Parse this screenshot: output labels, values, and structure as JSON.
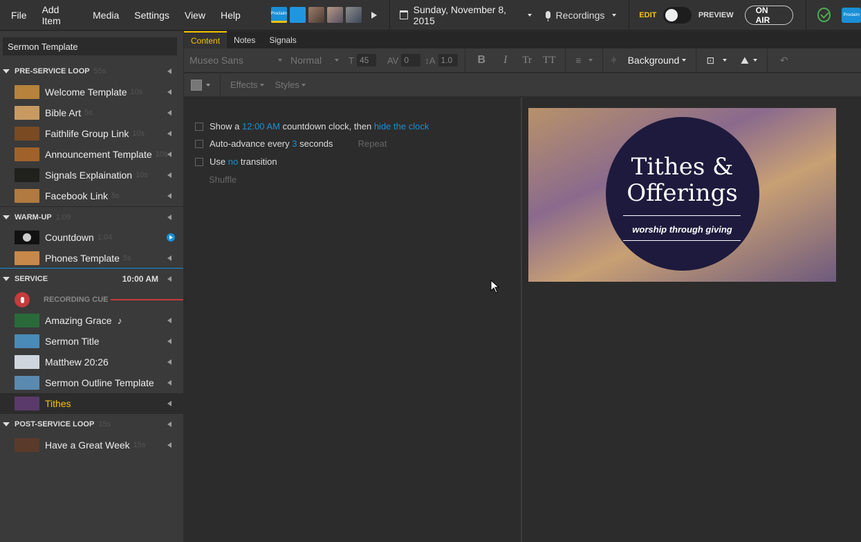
{
  "menu": [
    "File",
    "Add Item",
    "Media",
    "Settings",
    "View",
    "Help"
  ],
  "proclaim_logo_text": "Proclaim",
  "date": "Sunday, November 8, 2015",
  "recordings": "Recordings",
  "mode": {
    "edit": "EDIT",
    "preview": "PREVIEW"
  },
  "on_air": "ON AIR",
  "search": {
    "value": "Sermon Template"
  },
  "sections": [
    {
      "title": "PRE-SERVICE LOOP",
      "duration": "55s",
      "items": [
        {
          "label": "Welcome Template",
          "duration": "10s",
          "color": "#b7823c"
        },
        {
          "label": "Bible Art",
          "duration": "5s",
          "color": "#c89a62"
        },
        {
          "label": "Faithlife Group Link",
          "duration": "10s",
          "color": "#7a4a22"
        },
        {
          "label": "Announcement Template",
          "duration": "10s",
          "color": "#a0622a"
        },
        {
          "label": "Signals Explaination",
          "duration": "10s",
          "color": "#20201c"
        },
        {
          "label": "Facebook Link",
          "duration": "5s",
          "color": "#b07a40"
        }
      ]
    },
    {
      "title": "WARM-UP",
      "duration": "1:09",
      "items": [
        {
          "label": "Countdown",
          "duration": "1:04",
          "color": "#111111"
        },
        {
          "label": "Phones Template",
          "duration": "5s",
          "color": "#c8884a"
        }
      ]
    },
    {
      "title": "SERVICE",
      "time": "10:00 AM",
      "recording_cue": "RECORDING CUE",
      "items": [
        {
          "label": "Amazing Grace",
          "duration": "",
          "color": "#2a6a3a"
        },
        {
          "label": "Sermon Title",
          "duration": "",
          "color": "#4a8ab8"
        },
        {
          "label": "Matthew 20:26",
          "duration": "",
          "color": "#cfd6de"
        },
        {
          "label": "Sermon Outline Template",
          "duration": "",
          "color": "#5a8ab0"
        },
        {
          "label": "Tithes",
          "duration": "",
          "color": "#5a3a6a"
        }
      ]
    },
    {
      "title": "POST-SERVICE LOOP",
      "duration": "15s",
      "items": [
        {
          "label": "Have a Great Week",
          "duration": "15s",
          "color": "#5a3a2a"
        }
      ]
    }
  ],
  "tabs": [
    "Content",
    "Notes",
    "Signals"
  ],
  "toolbar": {
    "font": "Museo Sans",
    "weight": "Normal",
    "size": "45",
    "spacing": "0",
    "line_height": "1.0",
    "bold": "B",
    "italic": "I",
    "case1": "Tr",
    "case2": "TT",
    "background": "Background",
    "effects": "Effects",
    "styles": "Styles"
  },
  "options": {
    "opt1": {
      "pre": "Show a",
      "time": "12:00 AM",
      "mid": "countdown clock, then",
      "link": "hide the clock"
    },
    "opt2": {
      "pre": "Auto-advance every",
      "num": "3",
      "post": "seconds",
      "repeat": "Repeat"
    },
    "opt3": {
      "pre": "Use",
      "link": "no",
      "post": "transition"
    },
    "shuffle": "Shuffle"
  },
  "slide": {
    "title_line1": "Tithes &",
    "title_line2": "Offerings",
    "subtitle": "worship through giving"
  }
}
